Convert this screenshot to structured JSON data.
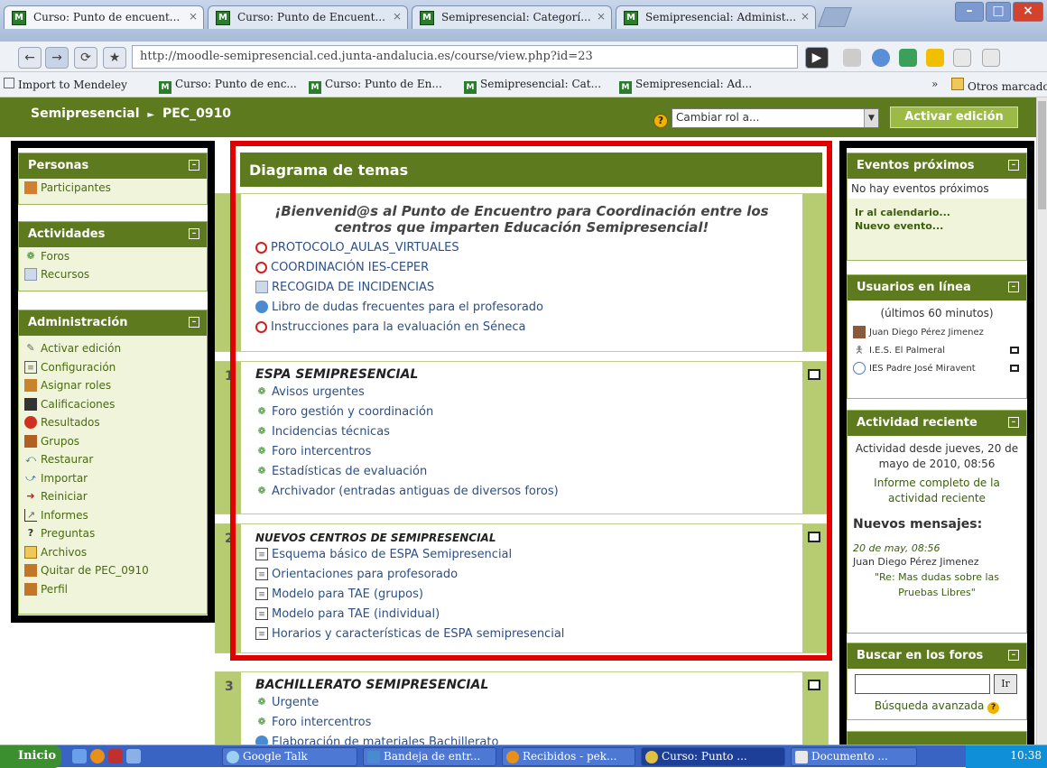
{
  "browser": {
    "tabs": [
      {
        "title": "Curso: Punto de encuent..."
      },
      {
        "title": "Curso: Punto de Encuent..."
      },
      {
        "title": "Semipresencial: Categorí..."
      },
      {
        "title": "Semipresencial: Administ..."
      }
    ],
    "url": "http://moodle-semipresencial.ced.junta-andalucia.es/course/view.php?id=23",
    "bookmarks": [
      {
        "label": "Import to Mendeley"
      },
      {
        "label": "Curso: Punto de enc..."
      },
      {
        "label": "Curso: Punto de En..."
      },
      {
        "label": "Semipresencial: Cat..."
      },
      {
        "label": "Semipresencial: Ad..."
      }
    ],
    "other_bookmarks": "Otros marcadores",
    "overflow": "»"
  },
  "header": {
    "site": "Semipresencial",
    "separator": "►",
    "course": "PEC_0910",
    "role_select": "Cambiar rol a...",
    "edit_button": "Activar edición"
  },
  "left": {
    "personas": {
      "title": "Personas",
      "items": [
        {
          "label": "Participantes",
          "icon": "people-icon"
        }
      ]
    },
    "actividades": {
      "title": "Actividades",
      "items": [
        {
          "label": "Foros",
          "icon": "forum-icon"
        },
        {
          "label": "Recursos",
          "icon": "resource-icon"
        }
      ]
    },
    "admin": {
      "title": "Administración",
      "items": [
        {
          "label": "Activar edición",
          "icon": "edit-icon"
        },
        {
          "label": "Configuración",
          "icon": "settings-icon"
        },
        {
          "label": "Asignar roles",
          "icon": "roles-icon"
        },
        {
          "label": "Calificaciones",
          "icon": "grades-icon"
        },
        {
          "label": "Resultados",
          "icon": "outcomes-icon"
        },
        {
          "label": "Grupos",
          "icon": "groups-icon"
        },
        {
          "label": "Restaurar",
          "icon": "restore-icon"
        },
        {
          "label": "Importar",
          "icon": "import-icon"
        },
        {
          "label": "Reiniciar",
          "icon": "reset-icon"
        },
        {
          "label": "Informes",
          "icon": "reports-icon"
        },
        {
          "label": "Preguntas",
          "icon": "questions-icon"
        },
        {
          "label": "Archivos",
          "icon": "folder-icon"
        },
        {
          "label": "Quitar de PEC_0910",
          "icon": "unenrol-icon"
        },
        {
          "label": "Perfil",
          "icon": "profile-icon"
        }
      ]
    }
  },
  "center": {
    "title": "Diagrama de temas",
    "welcome": "¡Bienvenid@s al Punto de Encuentro para Coordinación entre los centros que imparten Educación Semipresencial!",
    "section0": [
      {
        "label": "PROTOCOLO_AULAS_VIRTUALES",
        "icon": "pdf-icon"
      },
      {
        "label": "COORDINACIÓN IES-CEPER",
        "icon": "pdf-icon"
      },
      {
        "label": "RECOGIDA DE INCIDENCIAS",
        "icon": "document-icon"
      },
      {
        "label": "Libro de dudas frecuentes para el profesorado",
        "icon": "glossary-icon"
      },
      {
        "label": "Instrucciones para la evaluación en Séneca",
        "icon": "pdf-icon"
      }
    ],
    "section1": {
      "number": "1",
      "title": "ESPA SEMIPRESENCIAL",
      "items": [
        "Avisos urgentes",
        "Foro gestión y coordinación",
        "Incidencias técnicas",
        "Foro intercentros",
        "Estadísticas de evaluación",
        "Archivador (entradas antiguas de diversos foros)"
      ]
    },
    "section2": {
      "number": "2",
      "title": "NUEVOS CENTROS DE SEMIPRESENCIAL",
      "items": [
        "Esquema básico de ESPA Semipresencial",
        "Orientaciones para profesorado",
        "Modelo para TAE (grupos)",
        "Modelo para TAE (individual)",
        "Horarios y características de ESPA semipresencial"
      ]
    },
    "section3": {
      "number": "3",
      "title": "BACHILLERATO SEMIPRESENCIAL",
      "items": [
        "Urgente",
        "Foro intercentros",
        "Elaboración de materiales Bachillerato"
      ]
    }
  },
  "right": {
    "eventos": {
      "title": "Eventos próximos",
      "empty": "No hay eventos próximos",
      "calendar_link": "Ir al calendario...",
      "new_event": "Nuevo evento..."
    },
    "usuarios": {
      "title": "Usuarios en línea",
      "subtitle": "(últimos 60 minutos)",
      "users": [
        "Juan Diego Pérez Jimenez",
        "I.E.S. El Palmeral",
        "IES Padre José Miravent"
      ]
    },
    "actividad": {
      "title": "Actividad reciente",
      "since": "Actividad desde jueves, 20 de mayo de 2010, 08:56",
      "report": "Informe completo de la actividad reciente",
      "new_posts": "Nuevos mensajes:",
      "post_date": "20 de may, 08:56",
      "post_author": "Juan Diego Pérez Jimenez",
      "post_title": "\"Re: Mas dudas sobre las Pruebas Libres\""
    },
    "buscar": {
      "title": "Buscar en los foros",
      "button": "Ir",
      "advanced": "Búsqueda avanzada"
    }
  },
  "taskbar": {
    "start": "Inicio",
    "items": [
      "Google Talk",
      "Bandeja de entr...",
      "Recibidos - pek...",
      "Curso: Punto ...",
      "Documento ..."
    ],
    "clock": "10:38"
  }
}
